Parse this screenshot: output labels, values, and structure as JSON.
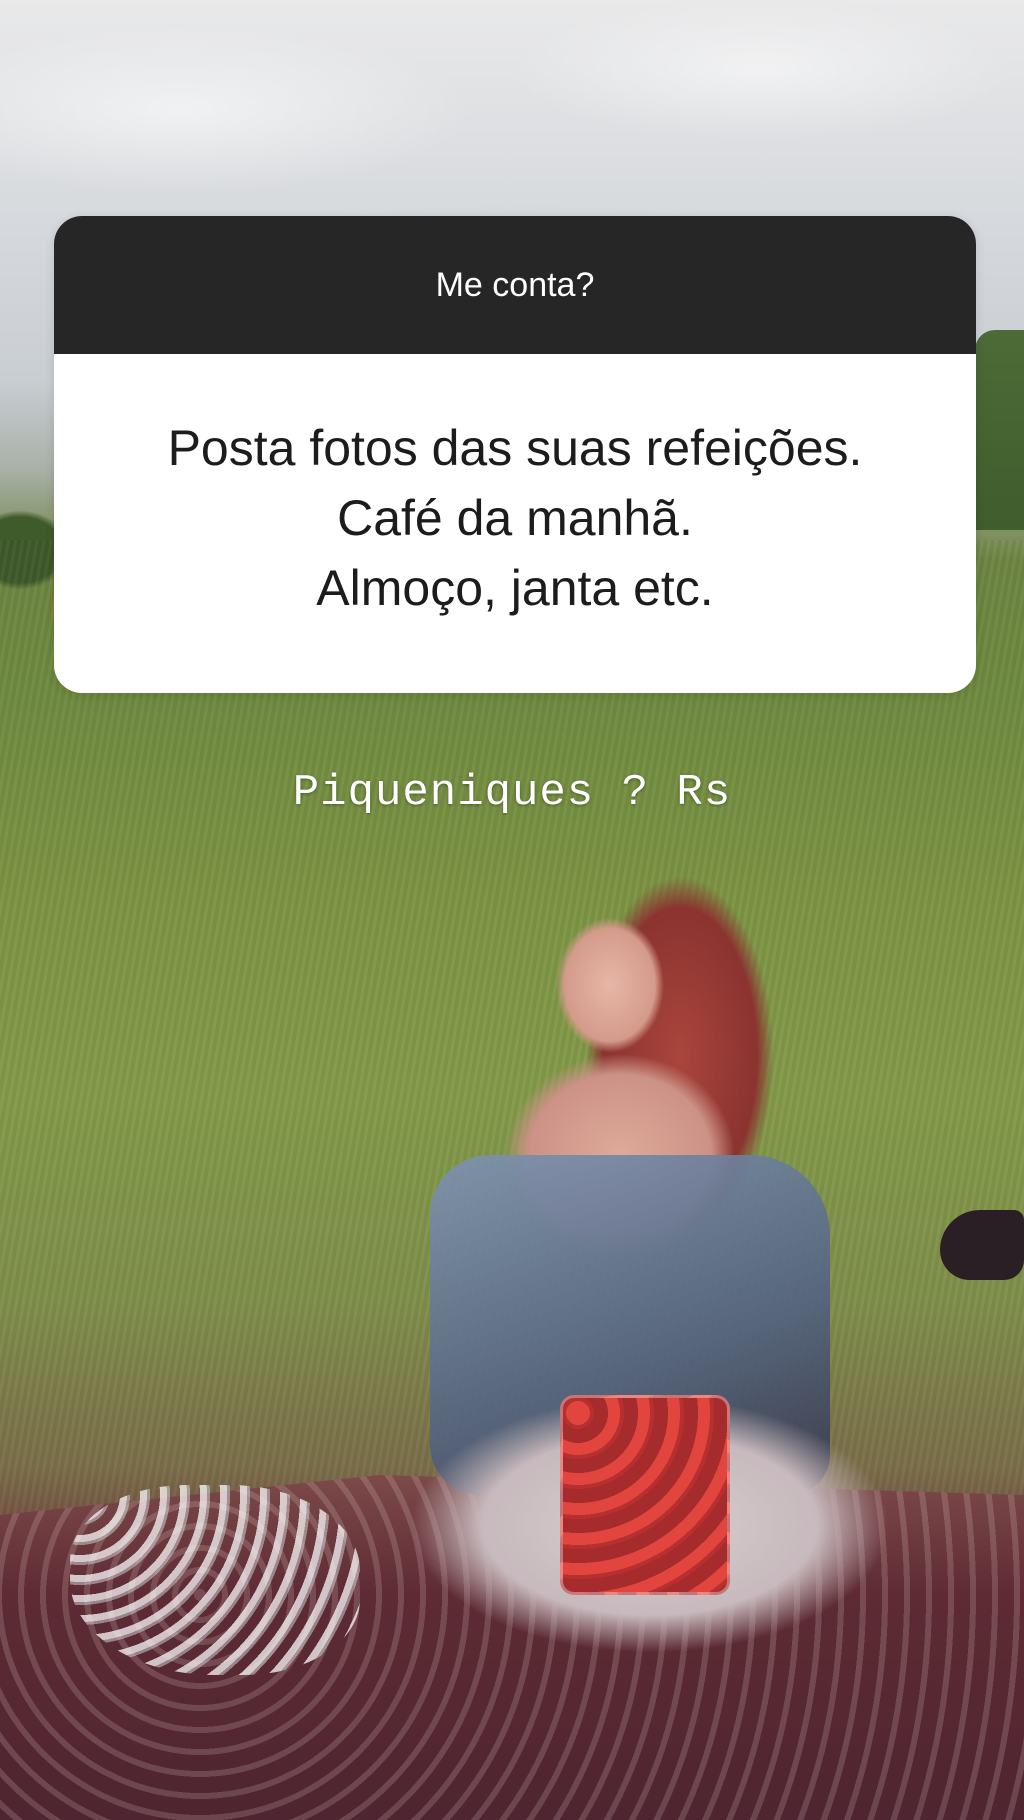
{
  "question_sticker": {
    "title": "Me conta?",
    "answer_lines": [
      "Posta fotos das suas refeições.",
      "Café da manhã.",
      "Almoço, janta etc."
    ]
  },
  "caption": "Piqueniques ? Rs",
  "colors": {
    "sticker_header": "#262626",
    "sticker_body": "#ffffff",
    "caption_text": "#ffffff"
  }
}
